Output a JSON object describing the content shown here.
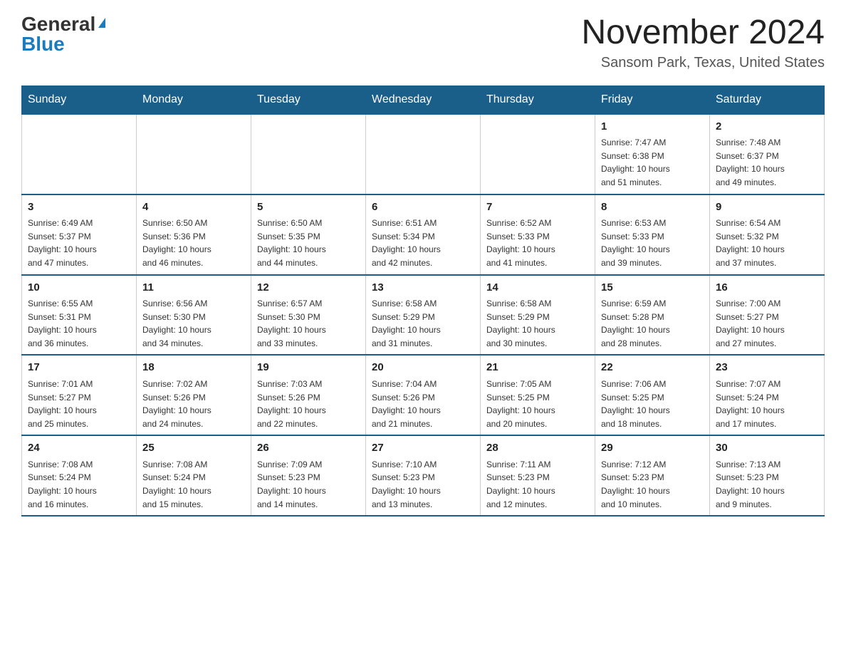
{
  "logo": {
    "general": "General",
    "blue": "Blue"
  },
  "title": "November 2024",
  "location": "Sansom Park, Texas, United States",
  "days_of_week": [
    "Sunday",
    "Monday",
    "Tuesday",
    "Wednesday",
    "Thursday",
    "Friday",
    "Saturday"
  ],
  "weeks": [
    [
      {
        "day": "",
        "info": ""
      },
      {
        "day": "",
        "info": ""
      },
      {
        "day": "",
        "info": ""
      },
      {
        "day": "",
        "info": ""
      },
      {
        "day": "",
        "info": ""
      },
      {
        "day": "1",
        "info": "Sunrise: 7:47 AM\nSunset: 6:38 PM\nDaylight: 10 hours\nand 51 minutes."
      },
      {
        "day": "2",
        "info": "Sunrise: 7:48 AM\nSunset: 6:37 PM\nDaylight: 10 hours\nand 49 minutes."
      }
    ],
    [
      {
        "day": "3",
        "info": "Sunrise: 6:49 AM\nSunset: 5:37 PM\nDaylight: 10 hours\nand 47 minutes."
      },
      {
        "day": "4",
        "info": "Sunrise: 6:50 AM\nSunset: 5:36 PM\nDaylight: 10 hours\nand 46 minutes."
      },
      {
        "day": "5",
        "info": "Sunrise: 6:50 AM\nSunset: 5:35 PM\nDaylight: 10 hours\nand 44 minutes."
      },
      {
        "day": "6",
        "info": "Sunrise: 6:51 AM\nSunset: 5:34 PM\nDaylight: 10 hours\nand 42 minutes."
      },
      {
        "day": "7",
        "info": "Sunrise: 6:52 AM\nSunset: 5:33 PM\nDaylight: 10 hours\nand 41 minutes."
      },
      {
        "day": "8",
        "info": "Sunrise: 6:53 AM\nSunset: 5:33 PM\nDaylight: 10 hours\nand 39 minutes."
      },
      {
        "day": "9",
        "info": "Sunrise: 6:54 AM\nSunset: 5:32 PM\nDaylight: 10 hours\nand 37 minutes."
      }
    ],
    [
      {
        "day": "10",
        "info": "Sunrise: 6:55 AM\nSunset: 5:31 PM\nDaylight: 10 hours\nand 36 minutes."
      },
      {
        "day": "11",
        "info": "Sunrise: 6:56 AM\nSunset: 5:30 PM\nDaylight: 10 hours\nand 34 minutes."
      },
      {
        "day": "12",
        "info": "Sunrise: 6:57 AM\nSunset: 5:30 PM\nDaylight: 10 hours\nand 33 minutes."
      },
      {
        "day": "13",
        "info": "Sunrise: 6:58 AM\nSunset: 5:29 PM\nDaylight: 10 hours\nand 31 minutes."
      },
      {
        "day": "14",
        "info": "Sunrise: 6:58 AM\nSunset: 5:29 PM\nDaylight: 10 hours\nand 30 minutes."
      },
      {
        "day": "15",
        "info": "Sunrise: 6:59 AM\nSunset: 5:28 PM\nDaylight: 10 hours\nand 28 minutes."
      },
      {
        "day": "16",
        "info": "Sunrise: 7:00 AM\nSunset: 5:27 PM\nDaylight: 10 hours\nand 27 minutes."
      }
    ],
    [
      {
        "day": "17",
        "info": "Sunrise: 7:01 AM\nSunset: 5:27 PM\nDaylight: 10 hours\nand 25 minutes."
      },
      {
        "day": "18",
        "info": "Sunrise: 7:02 AM\nSunset: 5:26 PM\nDaylight: 10 hours\nand 24 minutes."
      },
      {
        "day": "19",
        "info": "Sunrise: 7:03 AM\nSunset: 5:26 PM\nDaylight: 10 hours\nand 22 minutes."
      },
      {
        "day": "20",
        "info": "Sunrise: 7:04 AM\nSunset: 5:26 PM\nDaylight: 10 hours\nand 21 minutes."
      },
      {
        "day": "21",
        "info": "Sunrise: 7:05 AM\nSunset: 5:25 PM\nDaylight: 10 hours\nand 20 minutes."
      },
      {
        "day": "22",
        "info": "Sunrise: 7:06 AM\nSunset: 5:25 PM\nDaylight: 10 hours\nand 18 minutes."
      },
      {
        "day": "23",
        "info": "Sunrise: 7:07 AM\nSunset: 5:24 PM\nDaylight: 10 hours\nand 17 minutes."
      }
    ],
    [
      {
        "day": "24",
        "info": "Sunrise: 7:08 AM\nSunset: 5:24 PM\nDaylight: 10 hours\nand 16 minutes."
      },
      {
        "day": "25",
        "info": "Sunrise: 7:08 AM\nSunset: 5:24 PM\nDaylight: 10 hours\nand 15 minutes."
      },
      {
        "day": "26",
        "info": "Sunrise: 7:09 AM\nSunset: 5:23 PM\nDaylight: 10 hours\nand 14 minutes."
      },
      {
        "day": "27",
        "info": "Sunrise: 7:10 AM\nSunset: 5:23 PM\nDaylight: 10 hours\nand 13 minutes."
      },
      {
        "day": "28",
        "info": "Sunrise: 7:11 AM\nSunset: 5:23 PM\nDaylight: 10 hours\nand 12 minutes."
      },
      {
        "day": "29",
        "info": "Sunrise: 7:12 AM\nSunset: 5:23 PM\nDaylight: 10 hours\nand 10 minutes."
      },
      {
        "day": "30",
        "info": "Sunrise: 7:13 AM\nSunset: 5:23 PM\nDaylight: 10 hours\nand 9 minutes."
      }
    ]
  ]
}
